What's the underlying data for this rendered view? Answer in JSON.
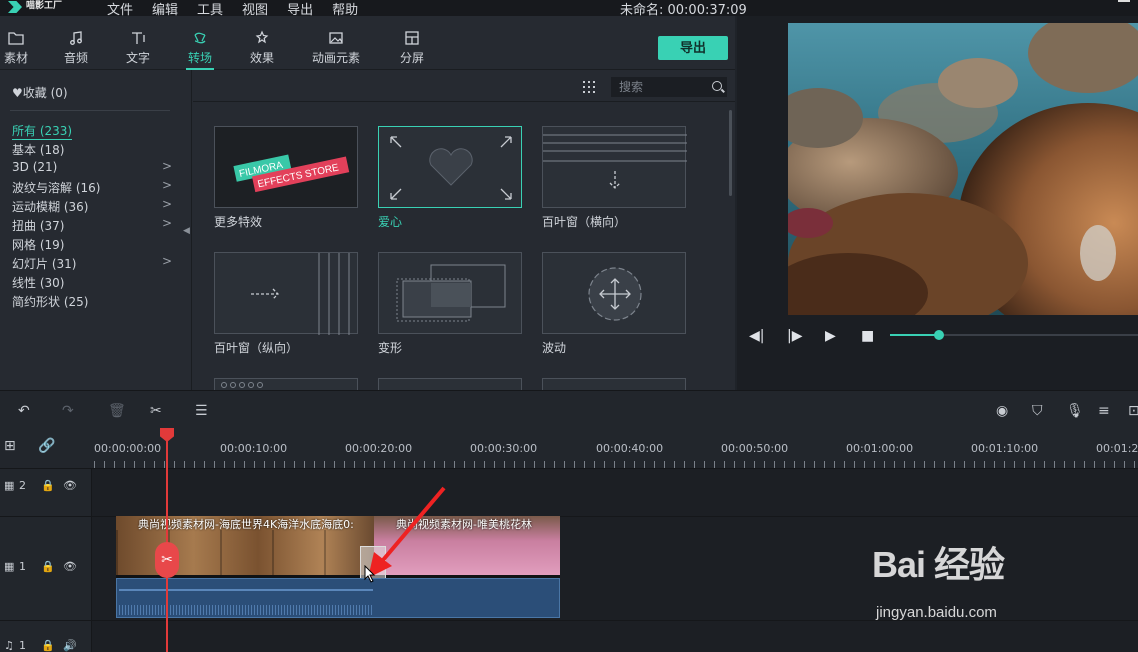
{
  "app": {
    "logo_text": "喵影工厂",
    "logo_sub": "filmora9"
  },
  "menu": [
    "文件",
    "编辑",
    "工具",
    "视图",
    "导出",
    "帮助"
  ],
  "project_title": "未命名: 00:00:37:09",
  "tabs": [
    {
      "label": "素材",
      "icon": "folder-icon"
    },
    {
      "label": "音频",
      "icon": "music-note-icon"
    },
    {
      "label": "文字",
      "icon": "text-icon"
    },
    {
      "label": "转场",
      "icon": "transition-icon",
      "active": true
    },
    {
      "label": "效果",
      "icon": "effects-icon"
    },
    {
      "label": "动画元素",
      "icon": "image-icon"
    },
    {
      "label": "分屏",
      "icon": "split-screen-icon"
    }
  ],
  "export_label": "导出",
  "sidebar": {
    "favorites": "收藏 (0)",
    "categories": [
      {
        "label": "所有 (233)",
        "selected": true,
        "expandable": false
      },
      {
        "label": "基本 (18)",
        "expandable": false
      },
      {
        "label": "3D (21)",
        "expandable": true
      },
      {
        "label": "波纹与溶解 (16)",
        "expandable": true
      },
      {
        "label": "运动模糊 (36)",
        "expandable": true
      },
      {
        "label": "扭曲 (37)",
        "expandable": true
      },
      {
        "label": "网格 (19)",
        "expandable": false
      },
      {
        "label": "幻灯片 (31)",
        "expandable": true
      },
      {
        "label": "线性 (30)",
        "expandable": false
      },
      {
        "label": "简约形状 (25)",
        "expandable": false
      }
    ]
  },
  "search": {
    "placeholder": "搜索"
  },
  "transitions": [
    {
      "label": "更多特效",
      "banner1": "FILMORA",
      "banner2": "EFFECTS STORE"
    },
    {
      "label": "爱心",
      "selected": true
    },
    {
      "label": "百叶窗（横向）"
    },
    {
      "label": "百叶窗（纵向）"
    },
    {
      "label": "变形"
    },
    {
      "label": "波动"
    }
  ],
  "timeline": {
    "ruler": [
      "00:00:00:00",
      "00:00:10:00",
      "00:00:20:00",
      "00:00:30:00",
      "00:00:40:00",
      "00:00:50:00",
      "00:01:00:00",
      "00:01:10:00",
      "00:01:2"
    ],
    "tracks": [
      {
        "label": "2",
        "type": "video"
      },
      {
        "label": "1",
        "type": "video"
      },
      {
        "label": "1",
        "type": "audio"
      }
    ],
    "clips": [
      {
        "title": "典尚视频素材网-海底世界4K海洋水底海底0:"
      },
      {
        "title": "典尚视频素材网-唯美桃花林"
      }
    ]
  },
  "watermark": {
    "text": "Bai 经验",
    "sub": "jingyan.baidu.com"
  },
  "colors": {
    "accent": "#39d1b4",
    "playhead": "#e23a3a",
    "audio": "#2b4e78"
  }
}
